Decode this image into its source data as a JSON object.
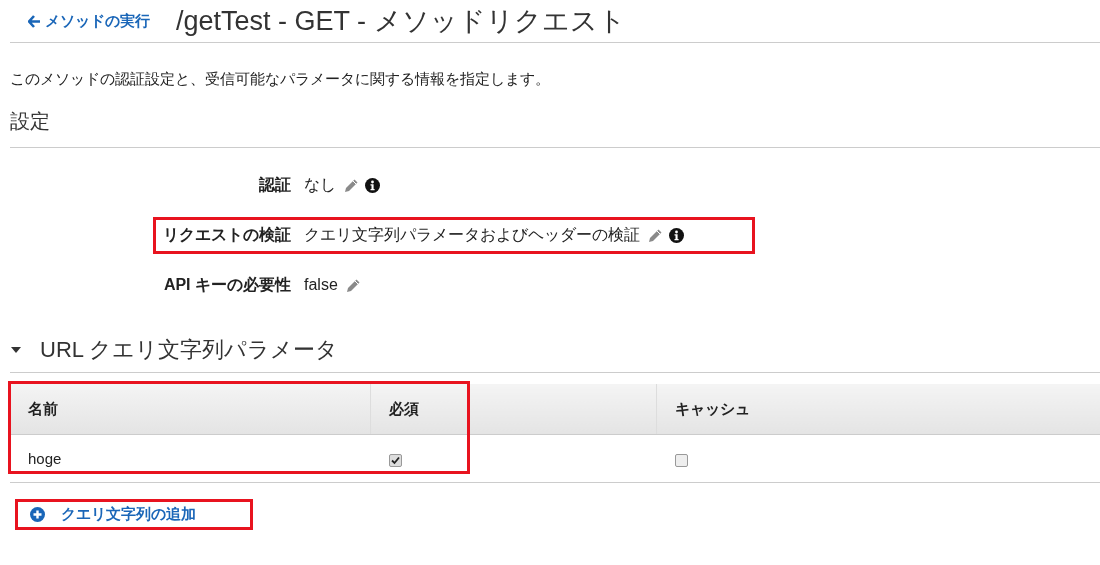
{
  "header": {
    "back_link": "メソッドの実行",
    "title": "/getTest - GET - メソッドリクエスト"
  },
  "description": "このメソッドの認証設定と、受信可能なパラメータに関する情報を指定します。",
  "settings": {
    "title": "設定",
    "rows": [
      {
        "label": "認証",
        "value": "なし",
        "info": true,
        "highlighted": false
      },
      {
        "label": "リクエストの検証",
        "value": "クエリ文字列パラメータおよびヘッダーの検証",
        "info": true,
        "highlighted": true
      },
      {
        "label": "API キーの必要性",
        "value": "false",
        "info": false,
        "highlighted": false
      }
    ]
  },
  "query_params": {
    "title": "URL クエリ文字列パラメータ",
    "expanded": true,
    "table": {
      "highlighted": true,
      "columns": [
        "名前",
        "必須",
        "キャッシュ"
      ],
      "rows": [
        {
          "name": "hoge",
          "required": true,
          "caching": false
        }
      ]
    },
    "add_link": {
      "label": "クエリ文字列の追加",
      "highlighted": true
    }
  }
}
